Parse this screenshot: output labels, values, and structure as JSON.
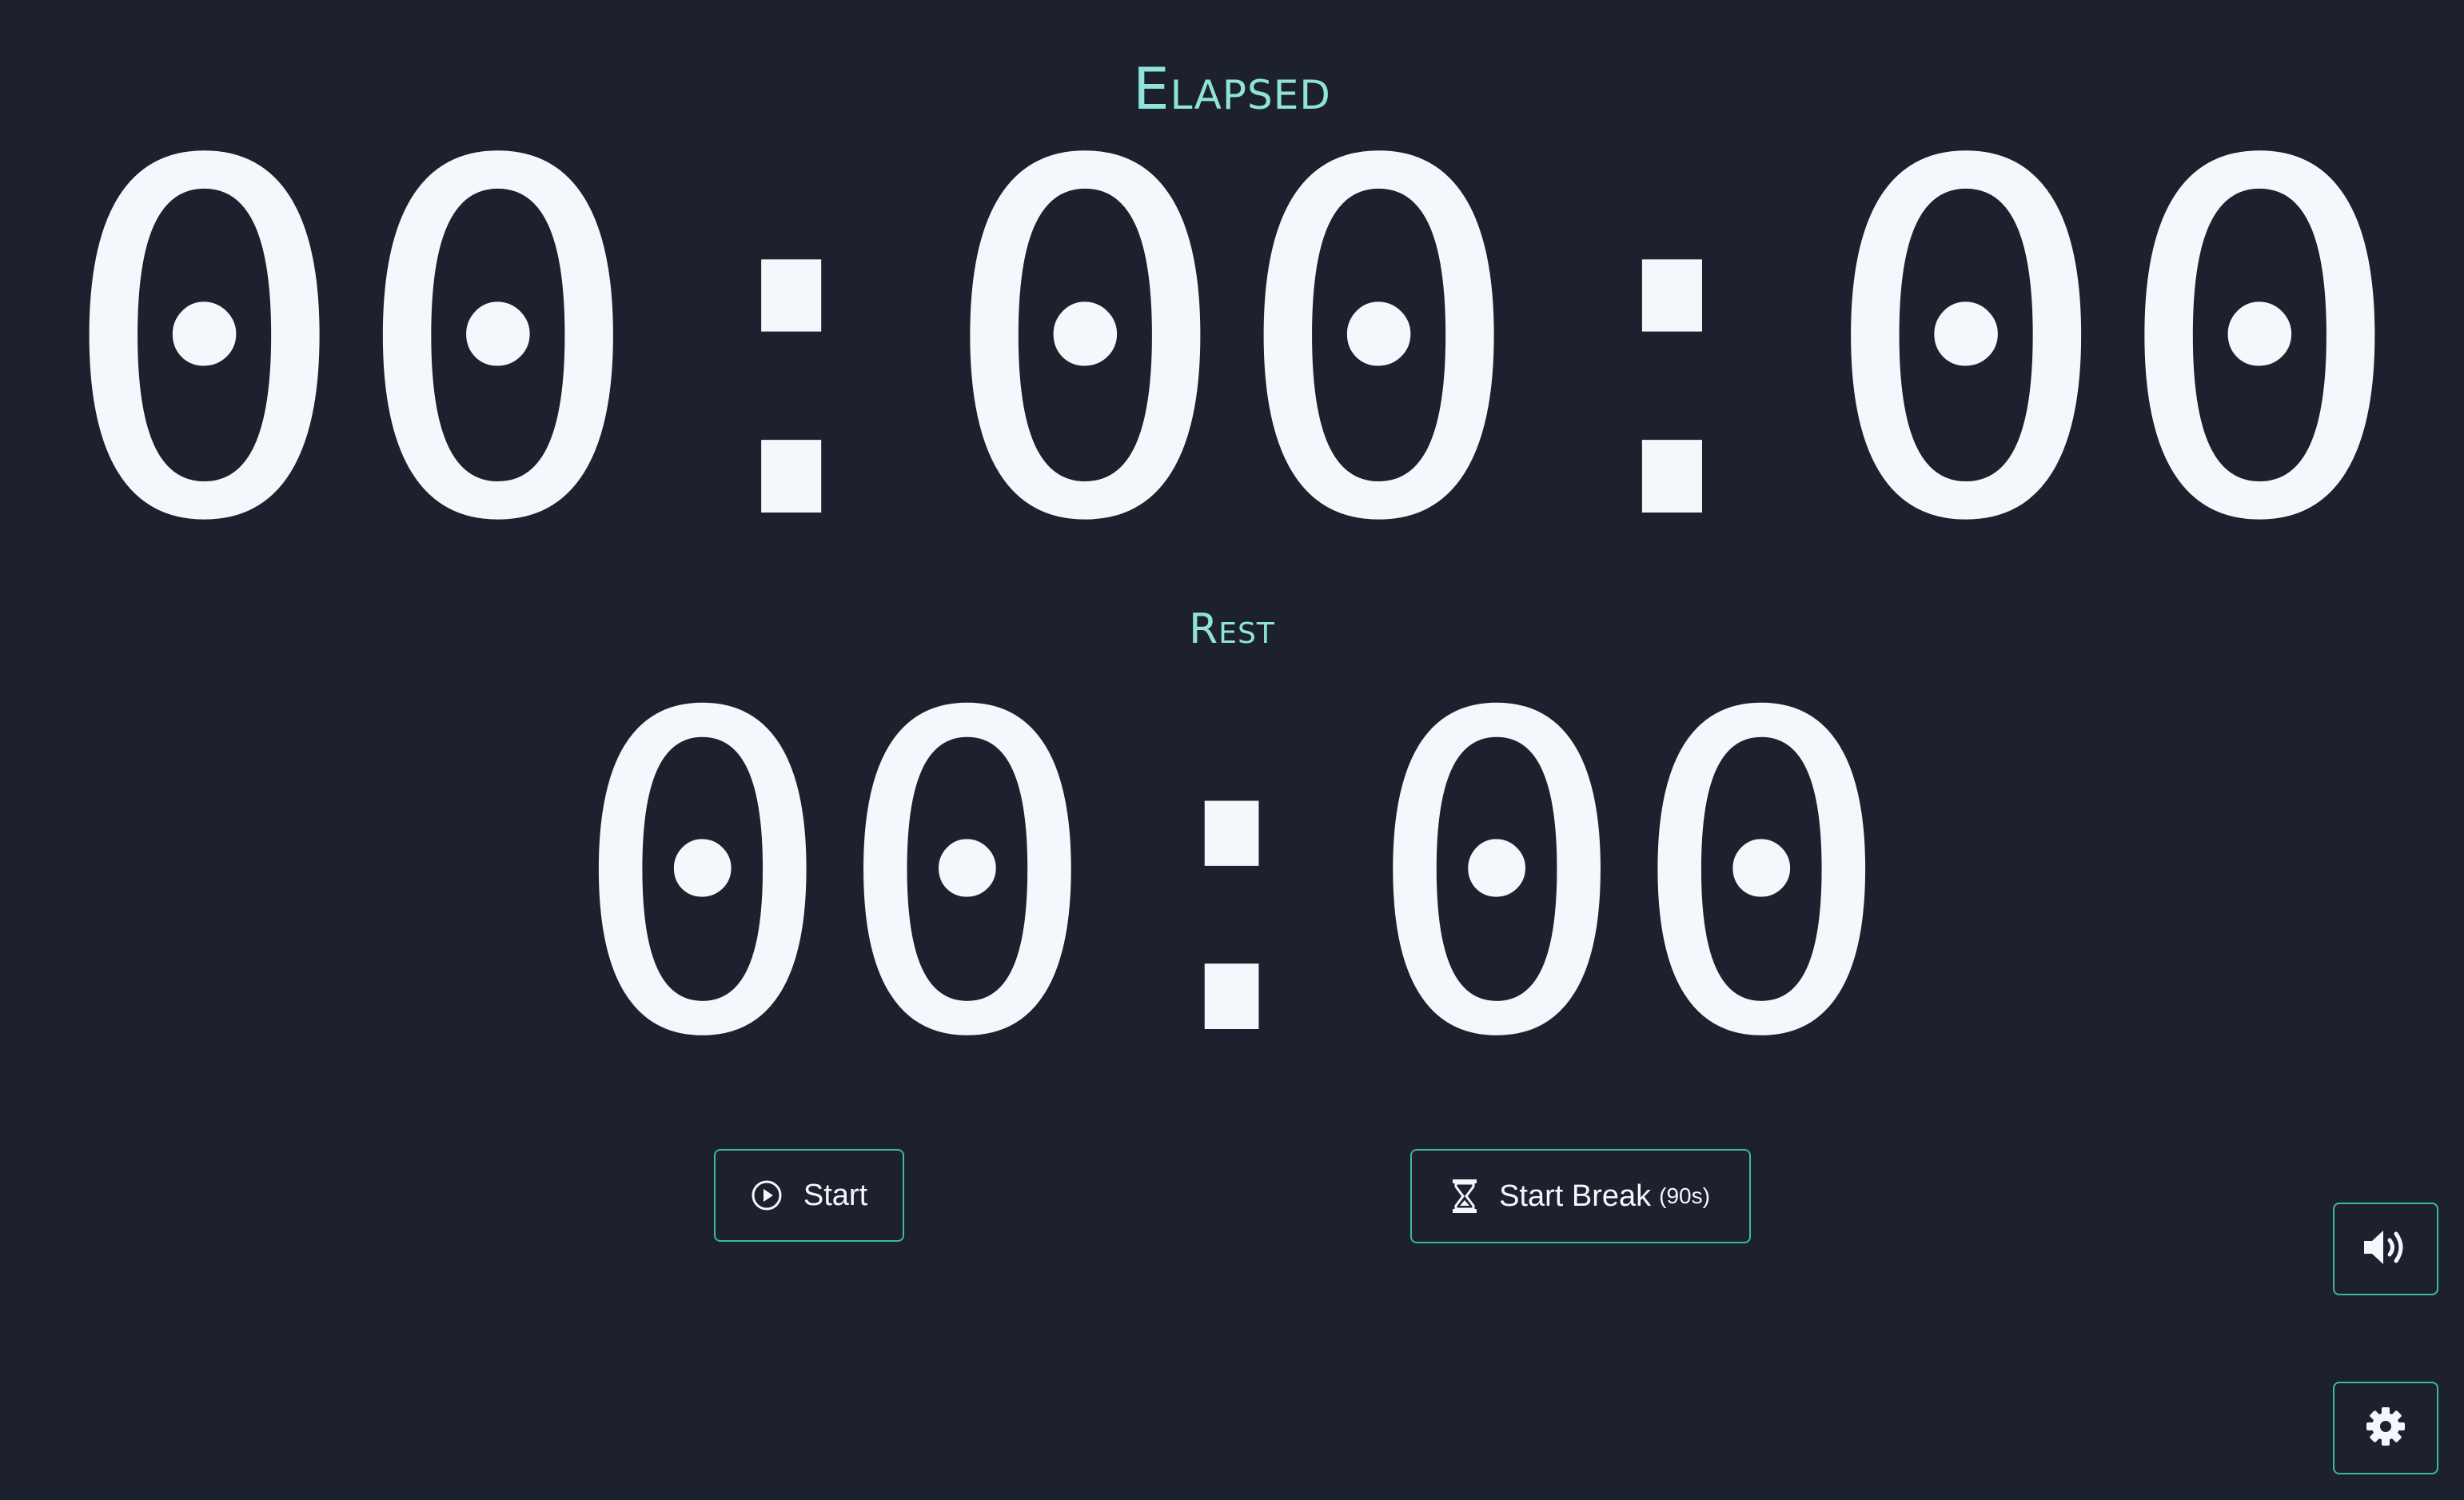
{
  "elapsed": {
    "label": "Elapsed",
    "time": "00:00:00"
  },
  "rest": {
    "label": "Rest",
    "time": "00:00"
  },
  "controls": {
    "start_label": "Start",
    "start_icon": "play-circle-icon",
    "break_label": "Start Break",
    "break_duration": "(90s)",
    "break_icon": "hourglass-icon",
    "sound_icon": "volume-icon",
    "settings_icon": "gear-icon"
  },
  "colors": {
    "background": "#1c212d",
    "accent": "#8fe3d8",
    "button_border": "#3fb6a8",
    "text": "#f4f8fc"
  }
}
